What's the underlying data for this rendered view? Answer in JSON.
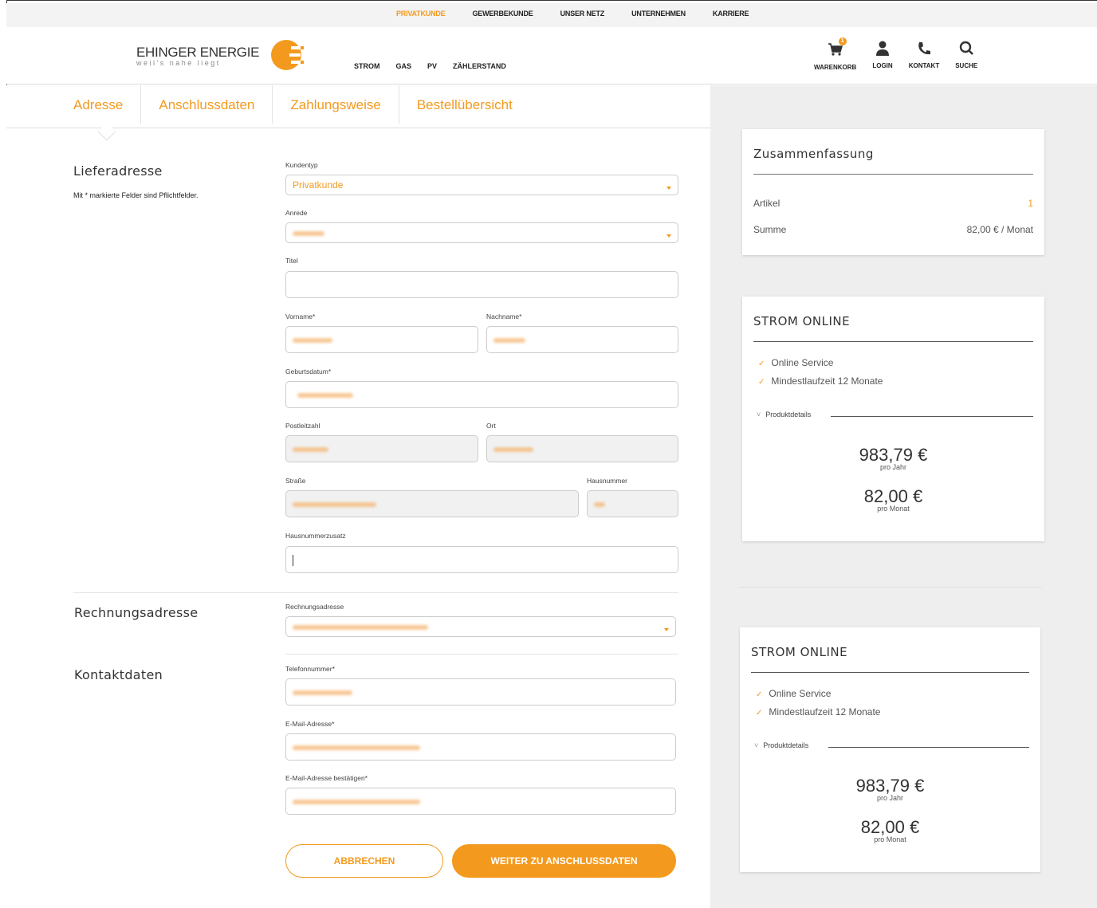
{
  "topnav": {
    "items": [
      "PRIVATKUNDE",
      "GEWERBEKUNDE",
      "UNSER NETZ",
      "UNTERNEHMEN",
      "KARRIERE"
    ]
  },
  "header": {
    "logo_text": "EHINGER ENERGIE",
    "logo_tagline": "weil's nahe liegt",
    "mainnav": [
      "STROM",
      "GAS",
      "PV",
      "ZÄHLERSTAND"
    ],
    "tools": {
      "cart": "WARENKORB",
      "cart_count": "1",
      "login": "LOGIN",
      "contact": "KONTAKT",
      "search": "SUCHE"
    }
  },
  "steps": [
    "Adresse",
    "Anschlussdaten",
    "Zahlungsweise",
    "Bestellübersicht"
  ],
  "form": {
    "lieferadresse_title": "Lieferadresse",
    "required_hint": "Mit * markierte Felder sind Pflichtfelder.",
    "kundentyp_label": "Kundentyp",
    "kundentyp_value": "Privatkunde",
    "anrede_label": "Anrede",
    "titel_label": "Titel",
    "vorname_label": "Vorname*",
    "nachname_label": "Nachname*",
    "geburtsdatum_label": "Geburtsdatum*",
    "plz_label": "Postleitzahl",
    "ort_label": "Ort",
    "strasse_label": "Straße",
    "hausnummer_label": "Hausnummer",
    "hausnummerzusatz_label": "Hausnummerzusatz",
    "rechnungsadresse_title": "Rechnungsadresse",
    "rechnungsadresse_label": "Rechnungsadresse",
    "kontaktdaten_title": "Kontaktdaten",
    "telefon_label": "Telefonnummer*",
    "email_label": "E-Mail-Adresse*",
    "email_confirm_label": "E-Mail-Adresse bestätigen*",
    "cancel_button": "ABBRECHEN",
    "next_button": "WEITER ZU ANSCHLUSSDATEN"
  },
  "summary": {
    "title": "Zusammenfassung",
    "articles_label": "Artikel",
    "articles_value": "1",
    "total_label": "Summe",
    "total_value": "82,00 € / Monat"
  },
  "products": [
    {
      "title": "STROM ONLINE",
      "features": [
        "Online Service",
        "Mindestlaufzeit 12 Monate"
      ],
      "details_label": "Produktdetails",
      "price_year": "983,79 €",
      "price_year_unit": "pro Jahr",
      "price_month": "82,00 €",
      "price_month_unit": "pro Monat"
    },
    {
      "title": "STROM ONLINE",
      "features": [
        "Online Service",
        "Mindestlaufzeit 12 Monate"
      ],
      "details_label": "Produktdetails",
      "price_year": "983,79 €",
      "price_year_unit": "pro Jahr",
      "price_month": "82,00 €",
      "price_month_unit": "pro Monat"
    }
  ],
  "colors": {
    "accent": "#f39a1e",
    "sidebar_bg": "#eeeeee"
  }
}
